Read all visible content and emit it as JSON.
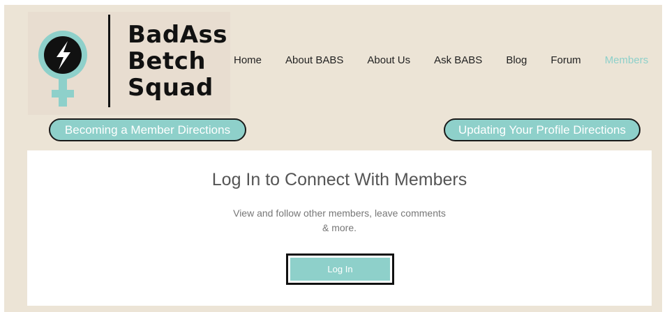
{
  "brand": {
    "line1": "BadAss",
    "line2": "Betch",
    "line3": "Squad"
  },
  "nav": {
    "items": [
      {
        "label": "Home"
      },
      {
        "label": "About BABS"
      },
      {
        "label": "About Us"
      },
      {
        "label": "Ask BABS"
      },
      {
        "label": "Blog"
      },
      {
        "label": "Forum"
      },
      {
        "label": "Members"
      }
    ],
    "active": "Members"
  },
  "buttons": {
    "member_directions": "Becoming a Member Directions",
    "profile_directions": "Updating Your Profile Directions"
  },
  "login_card": {
    "title": "Log In to Connect With Members",
    "description_line1": "View and follow other members, leave comments",
    "description_line2": "& more.",
    "button_label": "Log In"
  },
  "colors": {
    "background": "#ece4d6",
    "accent": "#8ed0ca",
    "text_dark": "#111111",
    "card": "#ffffff"
  },
  "icons": {
    "logo_symbol": "female-symbol-lightning-icon"
  }
}
